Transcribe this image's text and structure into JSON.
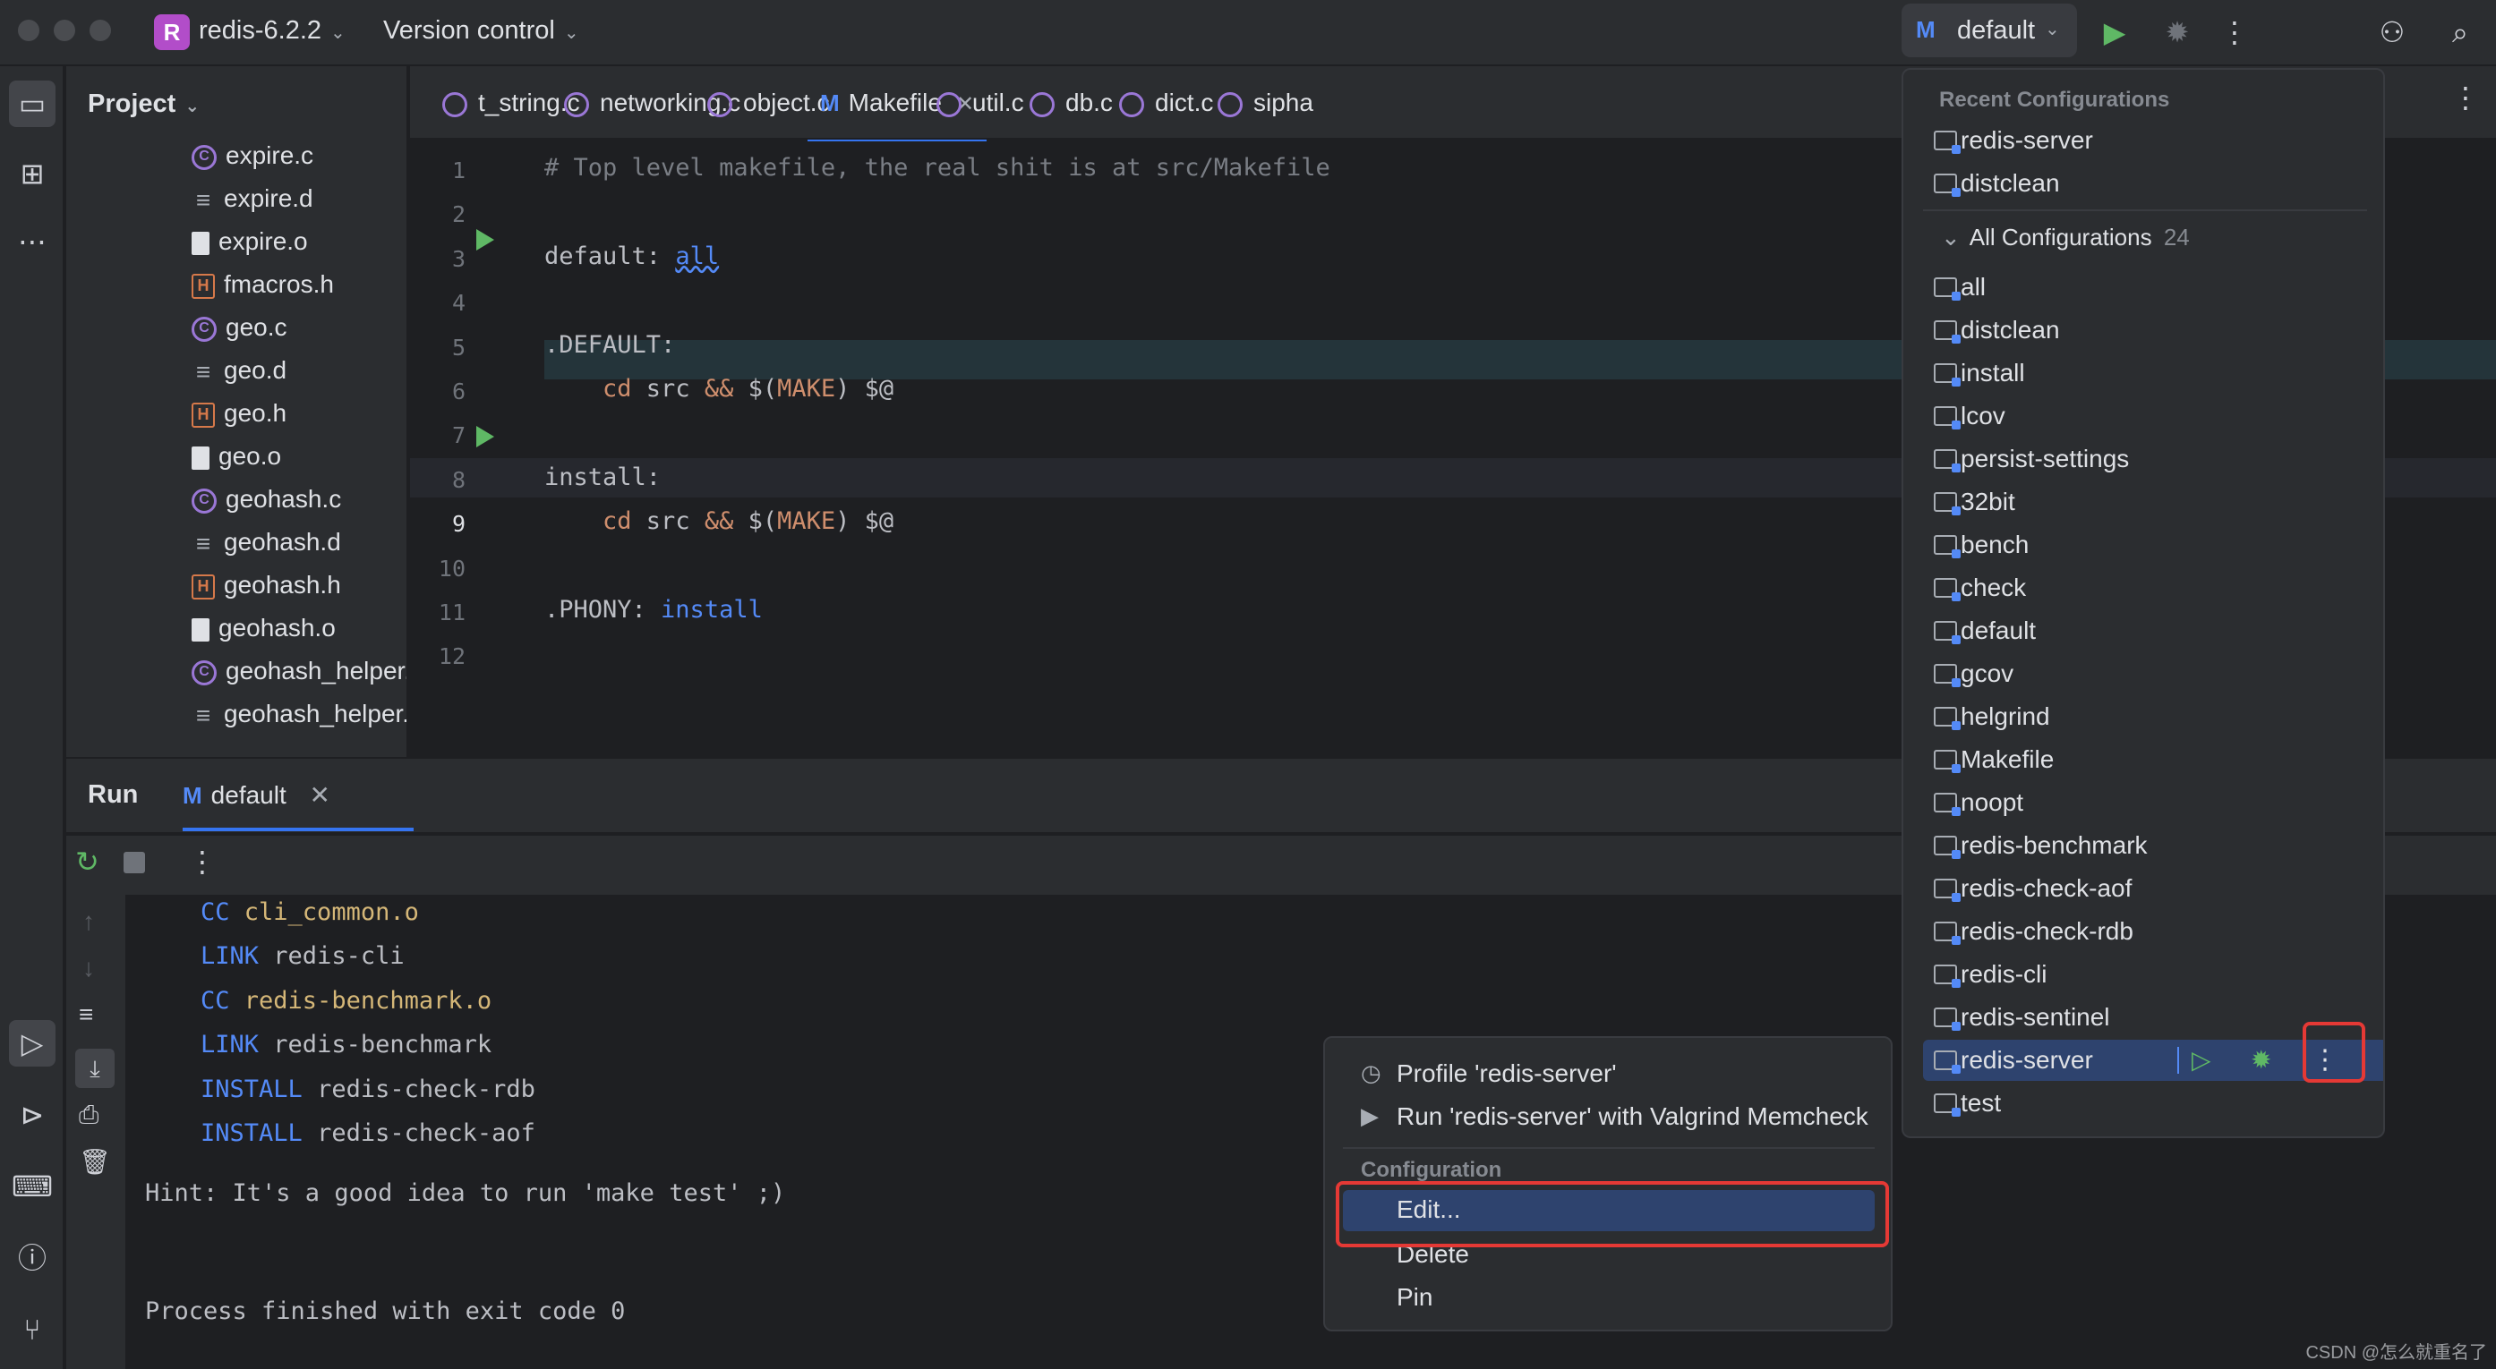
{
  "titlebar": {
    "project_badge": "R",
    "project_name": "redis-6.2.2",
    "vcs_label": "Version control",
    "run_config": "default",
    "icons": [
      "run-icon",
      "debug-icon",
      "more-icon",
      "add-user-icon",
      "search-icon"
    ]
  },
  "project_panel": {
    "title": "Project",
    "files": [
      {
        "name": "expire.c",
        "type": "c"
      },
      {
        "name": "expire.d",
        "type": "d"
      },
      {
        "name": "expire.o",
        "type": "o"
      },
      {
        "name": "fmacros.h",
        "type": "h"
      },
      {
        "name": "geo.c",
        "type": "c"
      },
      {
        "name": "geo.d",
        "type": "d"
      },
      {
        "name": "geo.h",
        "type": "h"
      },
      {
        "name": "geo.o",
        "type": "o"
      },
      {
        "name": "geohash.c",
        "type": "c"
      },
      {
        "name": "geohash.d",
        "type": "d"
      },
      {
        "name": "geohash.h",
        "type": "h"
      },
      {
        "name": "geohash.o",
        "type": "o"
      },
      {
        "name": "geohash_helper.",
        "type": "c"
      },
      {
        "name": "geohash_helper.",
        "type": "d"
      }
    ]
  },
  "tabs": [
    {
      "label": "t_string.c",
      "type": "c"
    },
    {
      "label": "networking.c",
      "type": "c"
    },
    {
      "label": "object.c",
      "type": "c"
    },
    {
      "label": "Makefile",
      "type": "make",
      "active": true
    },
    {
      "label": "util.c",
      "type": "c"
    },
    {
      "label": "db.c",
      "type": "c"
    },
    {
      "label": "dict.c",
      "type": "c"
    },
    {
      "label": "sipha",
      "type": "c"
    }
  ],
  "editor": {
    "warning_count": "1",
    "lines": [
      {
        "n": "1",
        "text": "# Top level makefile, the real shit is at src/Makefile"
      },
      {
        "n": "2",
        "text": ""
      },
      {
        "n": "3",
        "text": "default: all"
      },
      {
        "n": "4",
        "text": ""
      },
      {
        "n": "5",
        "text": ".DEFAULT:"
      },
      {
        "n": "6",
        "text": "    cd src && $(MAKE) $@"
      },
      {
        "n": "7",
        "text": ""
      },
      {
        "n": "8",
        "text": "install:"
      },
      {
        "n": "9",
        "text": "    cd src && $(MAKE) $@"
      },
      {
        "n": "10",
        "text": ""
      },
      {
        "n": "11",
        "text": ".PHONY: install"
      },
      {
        "n": "12",
        "text": ""
      }
    ]
  },
  "run_panel": {
    "title": "Run",
    "tab_label": "default",
    "console": [
      {
        "kw": "CC",
        "arg": "cli_common.o"
      },
      {
        "kw": "LINK",
        "arg": "redis-cli"
      },
      {
        "kw": "CC",
        "arg": "redis-benchmark.o"
      },
      {
        "kw": "LINK",
        "arg": "redis-benchmark"
      },
      {
        "kw": "INSTALL",
        "arg": "redis-check-rdb"
      },
      {
        "kw": "INSTALL",
        "arg": "redis-check-aof"
      }
    ],
    "hint": "Hint: It's a good idea to run 'make test' ;)",
    "exit": "Process finished with exit code 0"
  },
  "configs_popup": {
    "recent_title": "Recent Configurations",
    "recent": [
      "redis-server",
      "distclean"
    ],
    "all_title": "All Configurations",
    "all_count": "24",
    "all": [
      "all",
      "distclean",
      "install",
      "lcov",
      "persist-settings",
      "32bit",
      "bench",
      "check",
      "default",
      "gcov",
      "helgrind",
      "Makefile",
      "noopt",
      "redis-benchmark",
      "redis-check-aof",
      "redis-check-rdb",
      "redis-cli",
      "redis-sentinel",
      "redis-server",
      "test"
    ],
    "selected": "redis-server"
  },
  "context_menu": {
    "profile": "Profile 'redis-server'",
    "valgrind": "Run 'redis-server' with Valgrind Memcheck",
    "section": "Configuration",
    "edit": "Edit...",
    "delete": "Delete",
    "pin": "Pin"
  },
  "watermark": "CSDN @怎么就重名了",
  "colors": {
    "accent": "#3574f0",
    "selection": "#2e436e",
    "highlight_box": "#e53935",
    "run_green": "#5fb865"
  }
}
